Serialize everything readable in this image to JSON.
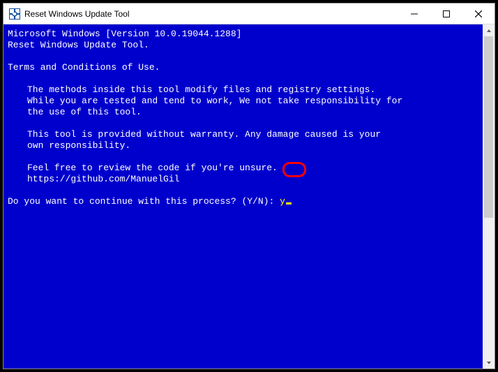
{
  "window": {
    "title": "Reset Windows Update Tool"
  },
  "console": {
    "line1": "Microsoft Windows [Version 10.0.19044.1288]",
    "line2": "Reset Windows Update Tool.",
    "termsHeader": "Terms and Conditions of Use.",
    "p1a": "The methods inside this tool modify files and registry settings.",
    "p1b": "While you are tested and tend to work, We not take responsibility for",
    "p1c": "the use of this tool.",
    "p2a": "This tool is provided without warranty. Any damage caused is your",
    "p2b": "own responsibility.",
    "p3a": "Feel free to review the code if you're unsure.",
    "p3b": "https://github.com/ManuelGil",
    "prompt": "Do you want to continue with this process? (Y/N): ",
    "answer": "y"
  }
}
